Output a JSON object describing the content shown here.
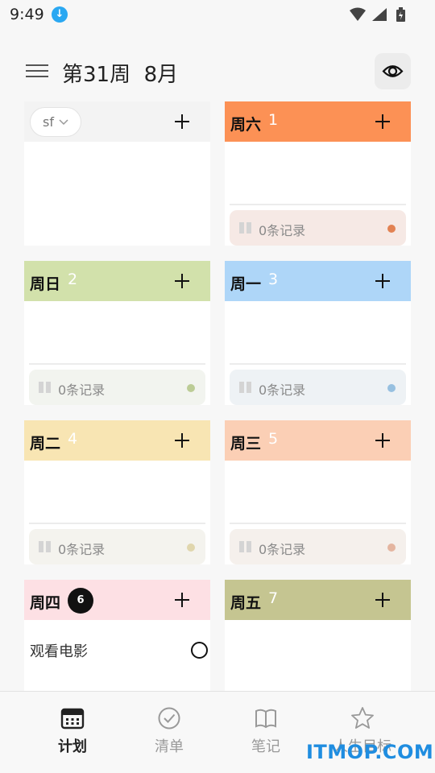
{
  "status_bar": {
    "time": "9:49"
  },
  "header": {
    "title": "第31周  8月"
  },
  "sf_card": {
    "chip_label": "sf"
  },
  "days": [
    {
      "label": "周六",
      "number": "1",
      "records": "0条记录",
      "color": "#fc9155",
      "bar_bg": "#f6e9e5",
      "dot": "#e28253"
    },
    {
      "label": "周日",
      "number": "2",
      "records": "0条记录",
      "color": "#d2e1ab",
      "bar_bg": "#f2f4ef",
      "dot": "#bccc96"
    },
    {
      "label": "周一",
      "number": "3",
      "records": "0条记录",
      "color": "#aed6f8",
      "bar_bg": "#eef2f5",
      "dot": "#97c0e0"
    },
    {
      "label": "周二",
      "number": "4",
      "records": "0条记录",
      "color": "#f8e5b3",
      "bar_bg": "#f4f3ee",
      "dot": "#e0d6ad"
    },
    {
      "label": "周三",
      "number": "5",
      "records": "0条记录",
      "color": "#fbcfb5",
      "bar_bg": "#f5f0ec",
      "dot": "#e4b5a0"
    },
    {
      "label": "周四",
      "number": "6",
      "color": "#fde0e4",
      "task": "观看电影"
    },
    {
      "label": "周五",
      "number": "7",
      "color": "#c5c591"
    }
  ],
  "nav": [
    {
      "label": "计划",
      "icon": "calendar-icon",
      "active": true
    },
    {
      "label": "清单",
      "icon": "check-circle-icon"
    },
    {
      "label": "笔记",
      "icon": "book-icon"
    },
    {
      "label": "人生目标",
      "icon": "star-icon"
    }
  ],
  "watermark": "ITMOP.COM"
}
